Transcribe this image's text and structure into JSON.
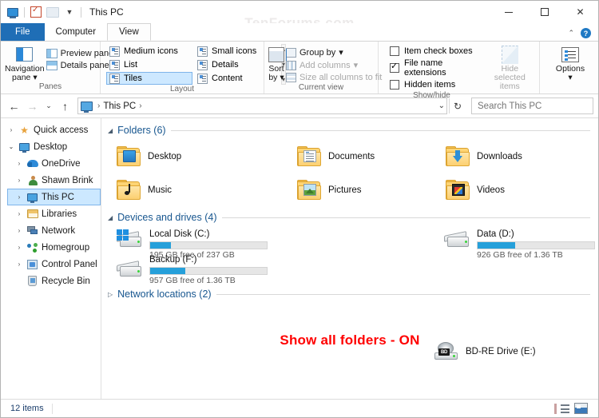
{
  "window": {
    "title": "This PC",
    "watermark": "TenForums.com",
    "quick_access_toolbar": [
      {
        "icon": "this-pc-icon",
        "name": "this-pc-qat"
      },
      {
        "icon": "properties-checkbox-icon",
        "name": "properties-qat"
      },
      {
        "icon": "new-folder-icon",
        "name": "new-folder-qat"
      },
      {
        "icon": "chevron-down-icon",
        "name": "customize-qat"
      }
    ],
    "controls": {
      "minimize": "minimize",
      "maximize": "maximize",
      "close": "close"
    }
  },
  "ribbon": {
    "tabs": [
      {
        "label": "File",
        "active": false,
        "type": "file"
      },
      {
        "label": "Computer",
        "active": false,
        "type": "normal"
      },
      {
        "label": "View",
        "active": true,
        "type": "normal"
      }
    ],
    "help": {
      "collapse": "collapse-ribbon",
      "help": "?"
    },
    "groups": [
      {
        "name": "Panes",
        "label": "Panes",
        "big_button": {
          "label": "Navigation\npane",
          "line1": "Navigation",
          "line2": "pane",
          "caret": "▾"
        },
        "small_buttons": [
          {
            "label": "Preview pane",
            "enabled": true
          },
          {
            "label": "Details pane",
            "enabled": true
          }
        ]
      },
      {
        "name": "Layout",
        "label": "Layout",
        "items": [
          {
            "label": "Medium icons",
            "selected": false
          },
          {
            "label": "Small icons",
            "selected": false
          },
          {
            "label": "List",
            "selected": false
          },
          {
            "label": "Details",
            "selected": false
          },
          {
            "label": "Tiles",
            "selected": true
          },
          {
            "label": "Content",
            "selected": false
          }
        ],
        "scroll": {
          "up": "▴",
          "mid": "▾",
          "more": "▾"
        }
      },
      {
        "name": "Current view",
        "label": "Current view",
        "big_button": {
          "line1": "Sort",
          "line2": "by",
          "caret": "▾"
        },
        "small_buttons": [
          {
            "label": "Group by",
            "enabled": true,
            "caret": "▾"
          },
          {
            "label": "Add columns",
            "enabled": false,
            "caret": "▾"
          },
          {
            "label": "Size all columns to fit",
            "enabled": false,
            "caret": ""
          }
        ]
      },
      {
        "name": "Show/hide",
        "label": "Show/hide",
        "checkboxes": [
          {
            "label": "Item check boxes",
            "checked": false
          },
          {
            "label": "File name extensions",
            "checked": true
          },
          {
            "label": "Hidden items",
            "checked": false
          }
        ],
        "big_button": {
          "line1": "Hide selected",
          "line2": "items",
          "enabled": false
        }
      },
      {
        "name": "Options",
        "label": "",
        "big_button": {
          "line1": "Options",
          "line2": "",
          "caret": "▾"
        }
      }
    ]
  },
  "addressbar": {
    "back": "←",
    "forward": "→",
    "recent": "⌄",
    "up": "↑",
    "breadcrumbs": [
      "This PC"
    ],
    "dropdown": "⌄",
    "refresh": "↻",
    "search": {
      "placeholder": "Search This PC",
      "value": ""
    }
  },
  "sidebar": {
    "items": [
      {
        "label": "Quick access",
        "indent": 0,
        "expander": "›",
        "icon": "star-icon",
        "selected": false
      },
      {
        "label": "Desktop",
        "indent": 0,
        "expander": "⌄",
        "icon": "monitor-icon",
        "selected": false
      },
      {
        "label": "OneDrive",
        "indent": 1,
        "expander": "›",
        "icon": "cloud-icon",
        "selected": false
      },
      {
        "label": "Shawn Brink",
        "indent": 1,
        "expander": "›",
        "icon": "user-icon",
        "selected": false
      },
      {
        "label": "This PC",
        "indent": 1,
        "expander": "›",
        "icon": "this-pc-icon",
        "selected": true
      },
      {
        "label": "Libraries",
        "indent": 1,
        "expander": "›",
        "icon": "libraries-icon",
        "selected": false
      },
      {
        "label": "Network",
        "indent": 1,
        "expander": "›",
        "icon": "network-icon",
        "selected": false
      },
      {
        "label": "Homegroup",
        "indent": 1,
        "expander": "›",
        "icon": "homegroup-icon",
        "selected": false
      },
      {
        "label": "Control Panel",
        "indent": 1,
        "expander": "›",
        "icon": "control-panel-icon",
        "selected": false
      },
      {
        "label": "Recycle Bin",
        "indent": 1,
        "expander": "",
        "icon": "recycle-bin-icon",
        "selected": false
      }
    ]
  },
  "content": {
    "sections": [
      {
        "name": "folders",
        "title": "Folders (6)",
        "expanded": true,
        "caret": "◢"
      },
      {
        "name": "devices",
        "title": "Devices and drives (4)",
        "expanded": true,
        "caret": "◢"
      },
      {
        "name": "network",
        "title": "Network locations (2)",
        "expanded": false,
        "caret": "▷"
      }
    ],
    "folders": [
      {
        "label": "Desktop",
        "icon": "folder-desktop-icon"
      },
      {
        "label": "Documents",
        "icon": "folder-documents-icon"
      },
      {
        "label": "Downloads",
        "icon": "folder-downloads-icon"
      },
      {
        "label": "Music",
        "icon": "folder-music-icon"
      },
      {
        "label": "Pictures",
        "icon": "folder-pictures-icon"
      },
      {
        "label": "Videos",
        "icon": "folder-videos-icon"
      }
    ],
    "drives": [
      {
        "name": "Local Disk (C:)",
        "free_text": "195 GB free of 237 GB",
        "used_percent": 18,
        "icon": "windows-drive-icon",
        "has_bar": true
      },
      {
        "name": "Data (D:)",
        "free_text": "926 GB free of 1.36 TB",
        "used_percent": 32,
        "icon": "hard-drive-icon",
        "has_bar": true
      },
      {
        "name": "BD-RE Drive (E:)",
        "free_text": "",
        "used_percent": 0,
        "icon": "bd-drive-icon",
        "has_bar": false
      },
      {
        "name": "Backup (F:)",
        "free_text": "957 GB free of 1.36 TB",
        "used_percent": 30,
        "icon": "hard-drive-icon",
        "has_bar": true
      }
    ],
    "annotation": "Show all folders - ON"
  },
  "statusbar": {
    "item_count": "12 items",
    "view_buttons": [
      {
        "name": "details-view-button",
        "active": false
      },
      {
        "name": "large-icons-view-button",
        "active": true
      }
    ]
  },
  "colors": {
    "accent": "#1f6eb6",
    "selection": "#cce8ff",
    "selection_border": "#7eb4ea",
    "progress_bar": "#26a0da",
    "section_header": "#17568f",
    "annotation_red": "#ff0000",
    "close_hover": "#e81123"
  }
}
